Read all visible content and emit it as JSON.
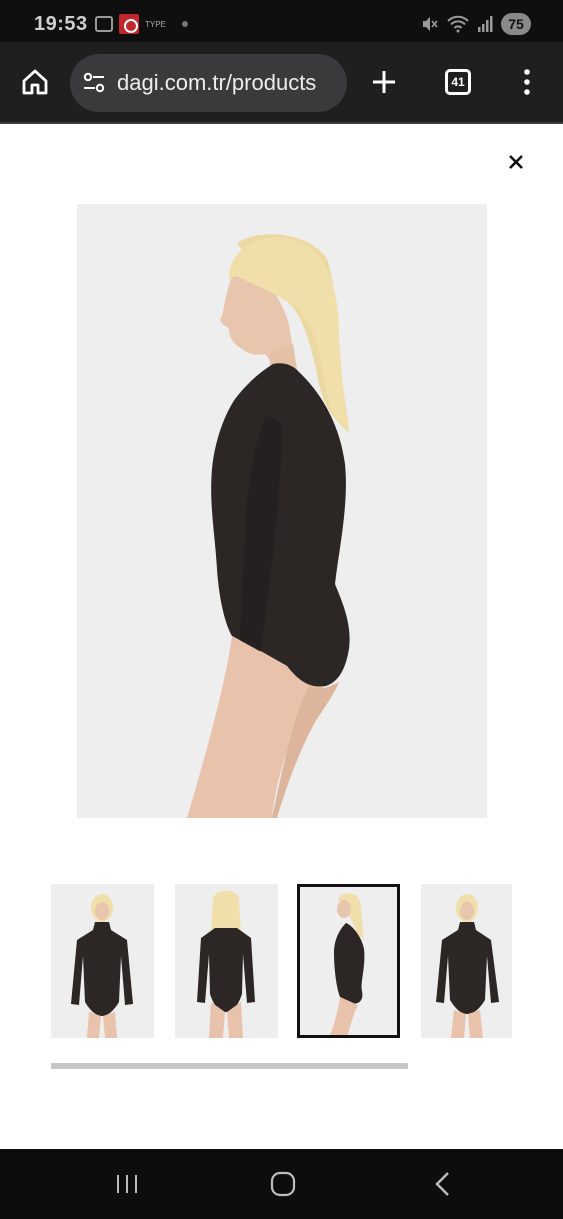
{
  "status_bar": {
    "time": "19:53",
    "notification_text": "TYPE",
    "battery": "75",
    "icons": [
      "screenshot-icon",
      "recorder-icon",
      "dot-icon",
      "mute-icon",
      "wifi-icon",
      "signal-icon",
      "battery-icon"
    ]
  },
  "browser": {
    "url": "dagi.com.tr/products",
    "tab_count": "41",
    "icons": [
      "home-icon",
      "site-settings-icon",
      "new-tab-icon",
      "tabs-icon",
      "menu-icon"
    ]
  },
  "gallery": {
    "selected_index": 2,
    "thumbnail_count": 4,
    "close_icon": "close-icon",
    "images": [
      {
        "name": "thumb-front",
        "pose": "front"
      },
      {
        "name": "thumb-back",
        "pose": "back"
      },
      {
        "name": "thumb-side",
        "pose": "side"
      },
      {
        "name": "thumb-front-2",
        "pose": "front"
      }
    ]
  },
  "colors": {
    "garment": "#2c2624",
    "background": "#eeeeef",
    "toolbar": "#1f1f1f",
    "selected_border": "#111111"
  },
  "nav": {
    "icons": [
      "recent-apps-icon",
      "home-button-icon",
      "back-icon"
    ]
  }
}
